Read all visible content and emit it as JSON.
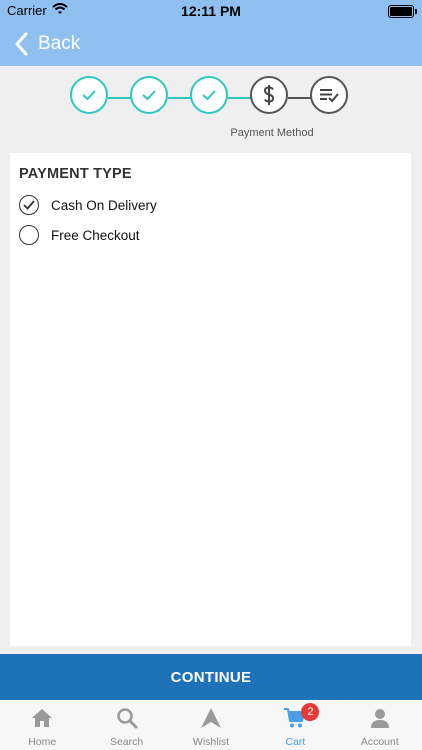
{
  "status_bar": {
    "carrier": "Carrier",
    "time": "12:11 PM"
  },
  "nav": {
    "back_label": "Back"
  },
  "checkout_steps": {
    "steps": [
      {
        "status": "done",
        "icon": "check-icon"
      },
      {
        "status": "done",
        "icon": "check-icon"
      },
      {
        "status": "done",
        "icon": "check-icon"
      },
      {
        "status": "current",
        "icon": "dollar-icon"
      },
      {
        "status": "pending",
        "icon": "review-list-icon"
      }
    ],
    "current_caption": "Payment Method"
  },
  "payment": {
    "title": "PAYMENT TYPE",
    "options": [
      {
        "label": "Cash On Delivery",
        "selected": true
      },
      {
        "label": "Free Checkout",
        "selected": false
      }
    ]
  },
  "continue_label": "CONTINUE",
  "tabbar": {
    "tabs": [
      {
        "label": "Home",
        "icon": "home-icon"
      },
      {
        "label": "Search",
        "icon": "search-icon"
      },
      {
        "label": "Wishlist",
        "icon": "wishlist-icon"
      },
      {
        "label": "Cart",
        "icon": "cart-icon",
        "badge": "2",
        "active": true
      },
      {
        "label": "Account",
        "icon": "account-icon"
      }
    ]
  },
  "colors": {
    "header": "#8fc0f0",
    "step_done": "#2ec7c0",
    "button": "#1d72b8",
    "active_tab": "#4a9ee6",
    "badge": "#e53935"
  }
}
